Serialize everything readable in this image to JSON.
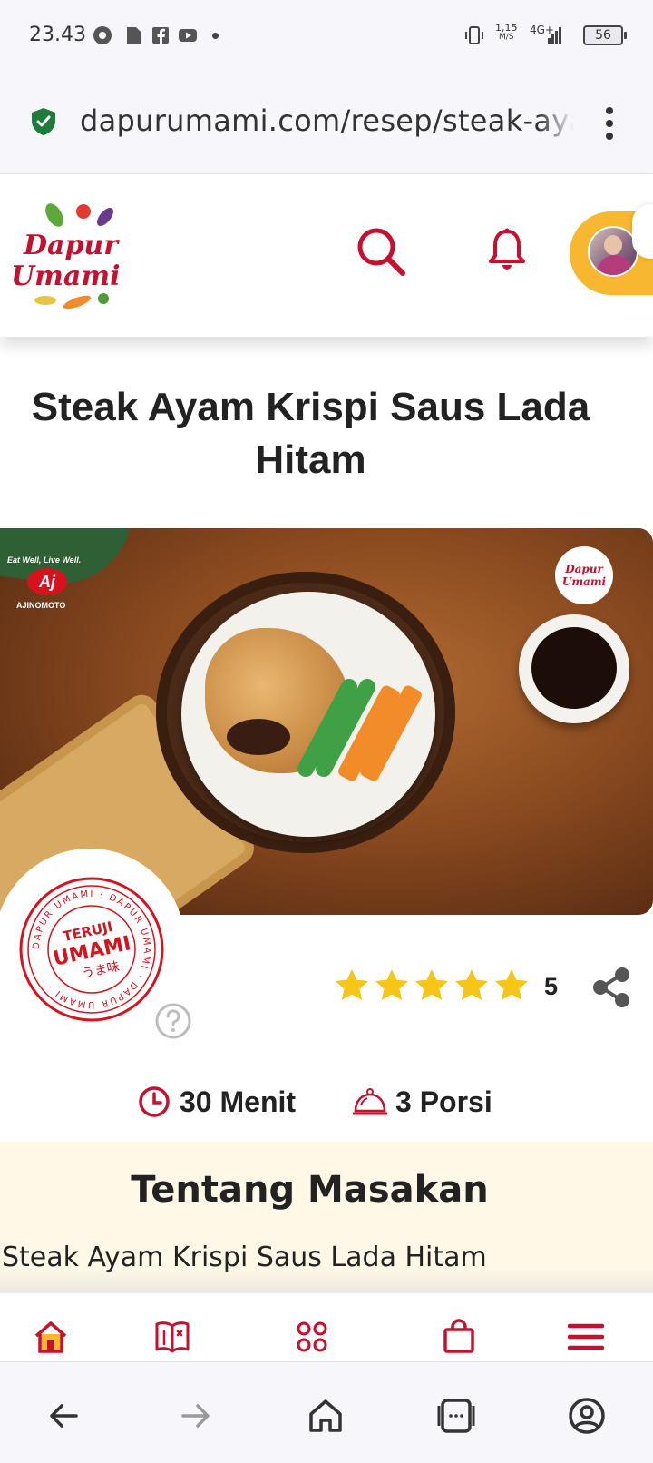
{
  "status_bar": {
    "time": "23.43",
    "net_speed": "1,15",
    "net_unit": "M/S",
    "network": "4G+",
    "battery": "56",
    "icons": [
      "screen-record-icon",
      "document-icon",
      "facebook-icon",
      "youtube-icon",
      "vibrate-icon",
      "signal-icon"
    ]
  },
  "browser": {
    "url": "dapurumami.com/resep/steak-ayam",
    "secure_icon": "shield-check-icon",
    "menu_icon": "more-vert-icon"
  },
  "site_header": {
    "logo_line1": "Dapur",
    "logo_line2": "Umami",
    "icons": [
      "search-icon",
      "bell-icon",
      "avatar"
    ]
  },
  "recipe": {
    "title": "Steak Ayam Krispi Saus Lada Hitam",
    "image_brand_tagline": "Eat Well, Live Well.",
    "image_brand_name": "AJINOMOTO",
    "image_badge_line1": "Dapur",
    "image_badge_line2": "Umami",
    "stamp_ring": "DAPUR UMAMI · DAPUR UMAMI · DAPUR UMAMI ·",
    "stamp_top": "TERUJI",
    "stamp_main": "UMAMI",
    "stamp_sub": "うま味",
    "rating": 5,
    "rating_label": "5",
    "time_label": "30 Menit",
    "serving_label": "3 Porsi"
  },
  "about": {
    "title": "Tentang Masakan",
    "text": "Steak Ayam Krispi Saus Lada Hitam"
  },
  "site_nav": [
    "home-icon",
    "recipe-book-icon",
    "grid-icon",
    "shopping-bag-icon",
    "menu-icon"
  ],
  "browser_nav": [
    "back-icon",
    "forward-icon",
    "home-icon",
    "tabs-icon",
    "account-icon"
  ],
  "colors": {
    "brand_red": "#c8102e",
    "accent_yellow": "#f7b731",
    "star_yellow": "#f5c518",
    "about_bg": "#fff8e7"
  }
}
